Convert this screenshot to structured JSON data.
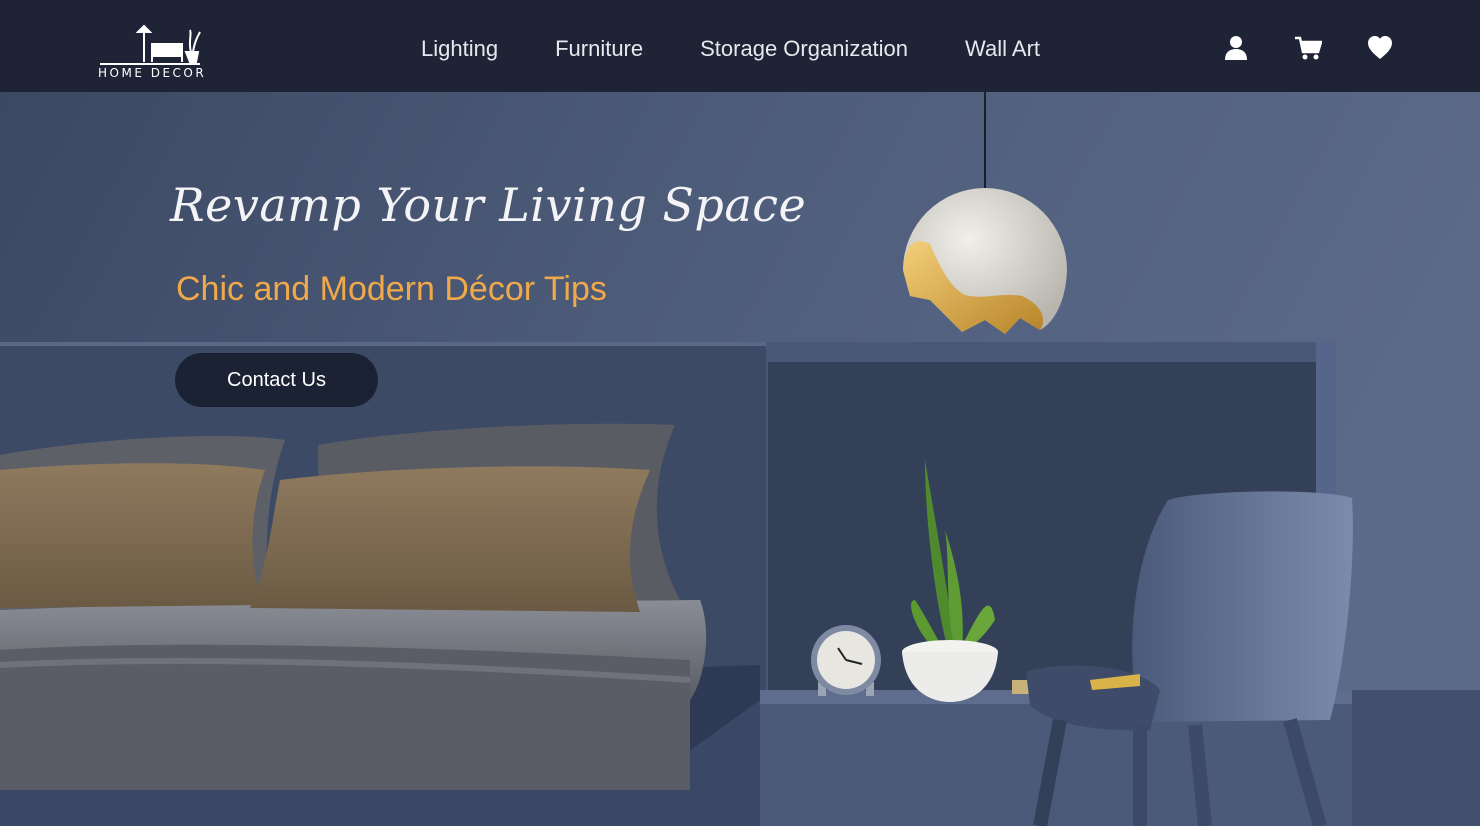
{
  "brand": {
    "logo_text": "HOME DECOR"
  },
  "nav": {
    "links": [
      "Lighting",
      "Furniture",
      "Storage Organization",
      "Wall Art"
    ],
    "icons": [
      "user-icon",
      "cart-icon",
      "heart-icon"
    ]
  },
  "hero": {
    "title": "Revamp Your Living Space",
    "subtitle": "Chic and Modern Décor Tips",
    "cta_label": "Contact Us"
  },
  "colors": {
    "navbar": "#1e2436",
    "wall": "#4a5872",
    "accent": "#f0a94a",
    "button": "#1b2233",
    "text": "#ffffff"
  }
}
